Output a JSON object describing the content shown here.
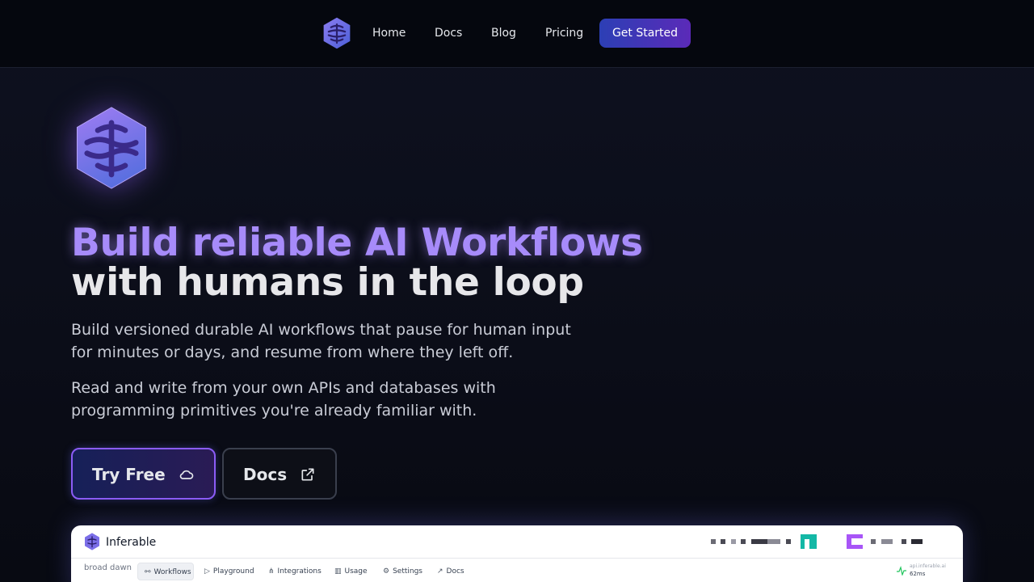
{
  "nav": {
    "links": [
      {
        "label": "Home"
      },
      {
        "label": "Docs"
      },
      {
        "label": "Blog"
      },
      {
        "label": "Pricing"
      }
    ],
    "cta_label": "Get Started"
  },
  "hero": {
    "headline_line1": "Build reliable AI Workflows",
    "headline_line2": "with humans in the loop",
    "paragraph1_line1": "Build versioned durable AI workflows that pause for human input",
    "paragraph1_line2": "for minutes or days, and resume from where they left off.",
    "paragraph2_line1": "Read and write from your own APIs and databases with",
    "paragraph2_line2": "programming primitives you're already familiar with.",
    "primary_button": "Try Free",
    "secondary_button": "Docs"
  },
  "preview": {
    "brand": "Inferable",
    "cluster_name": "broad dawn",
    "nav_items": [
      {
        "label": "Workflows",
        "icon": "workflow-icon",
        "active": true
      },
      {
        "label": "Playground",
        "icon": "play-icon"
      },
      {
        "label": "Integrations",
        "icon": "network-icon"
      },
      {
        "label": "Usage",
        "icon": "bar-chart-icon"
      },
      {
        "label": "Settings",
        "icon": "gear-icon"
      },
      {
        "label": "Docs",
        "icon": "external-link-icon"
      }
    ],
    "status_host": "api.inferable.ai",
    "status_latency": "62ms"
  },
  "colors": {
    "accent_purple": "#a78bfa",
    "cta_gradient_start": "#2c3fb5",
    "cta_gradient_end": "#5b2ab8",
    "status_green": "#22c55e"
  }
}
